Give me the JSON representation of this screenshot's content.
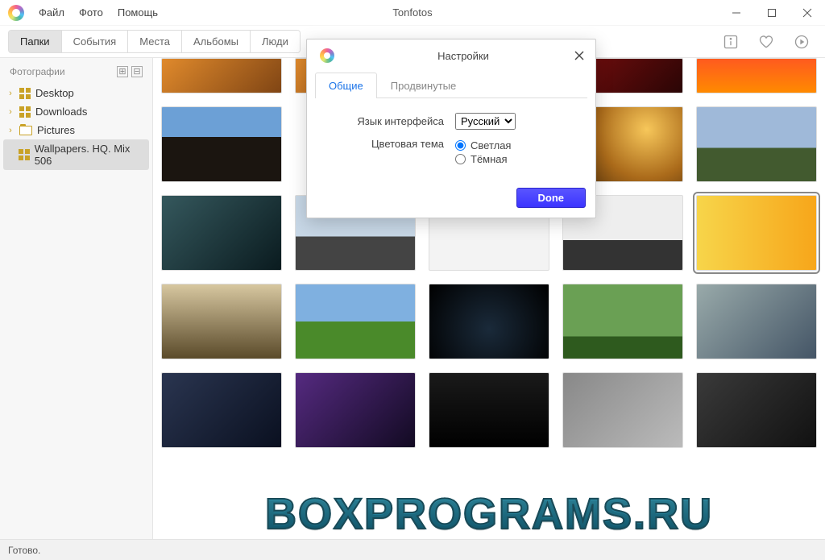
{
  "app": {
    "title": "Tonfotos"
  },
  "menu": {
    "file": "Файл",
    "photo": "Фото",
    "help": "Помощь"
  },
  "tabs": {
    "folders": "Папки",
    "events": "События",
    "places": "Места",
    "albums": "Альбомы",
    "people": "Люди"
  },
  "sidebar": {
    "header": "Фотографии",
    "items": [
      {
        "label": "Desktop"
      },
      {
        "label": "Downloads"
      },
      {
        "label": "Pictures"
      },
      {
        "label": "Wallpapers. HQ. Mix 506"
      }
    ]
  },
  "status": {
    "text": "Готово."
  },
  "dialog": {
    "title": "Настройки",
    "tabs": {
      "general": "Общие",
      "advanced": "Продвинутые"
    },
    "lang_label": "Язык интерфейса",
    "lang_value": "Русский",
    "theme_label": "Цветовая тема",
    "theme_light": "Светлая",
    "theme_dark": "Тёмная",
    "done": "Done"
  },
  "watermark": "BOXPROGRAMS.RU"
}
